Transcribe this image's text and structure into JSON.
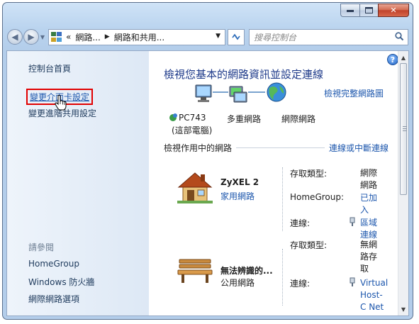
{
  "window": {
    "nav_path": {
      "seg1": "網路...",
      "seg2": "網路和共用..."
    },
    "search_placeholder": "搜尋控制台",
    "caption": {
      "min": "▭",
      "max": "▢",
      "close": "✕"
    }
  },
  "sidebar": {
    "title": "控制台首頁",
    "adapter_link": "變更介面卡設定",
    "sharing_link": "變更進階共用設定",
    "see_also": "請參閱",
    "items": [
      "HomeGroup",
      "Windows 防火牆",
      "網際網路選項"
    ]
  },
  "main": {
    "title": "檢視您基本的網路資訊並設定連線",
    "view_full": "檢視完整網路圖",
    "nodes": {
      "pc": "PC743",
      "pc_sub": "(這部電腦)",
      "multi": "多重網路",
      "internet": "網際網路"
    },
    "active_title": "檢視作用中的網路",
    "connect_link": "連線或中斷連線",
    "networks": [
      {
        "name": "ZyXEL  2",
        "type": "家用網路",
        "access_label": "存取類型:",
        "access_value": "網際網路",
        "hg_label": "HomeGroup:",
        "hg_value": "已加入",
        "conn_label": "連線:",
        "conn_value": "區域連線"
      },
      {
        "name": "無法辨識的...",
        "type": "公用網路",
        "access_label": "存取類型:",
        "access_value": "無網路存取",
        "conn_label": "連線:",
        "conn_value": "Virtual Host-C Netwo"
      }
    ]
  },
  "colors": {
    "accent": "#1d57ad",
    "highlight_box": "#e10000",
    "title": "#1e3a8a"
  }
}
